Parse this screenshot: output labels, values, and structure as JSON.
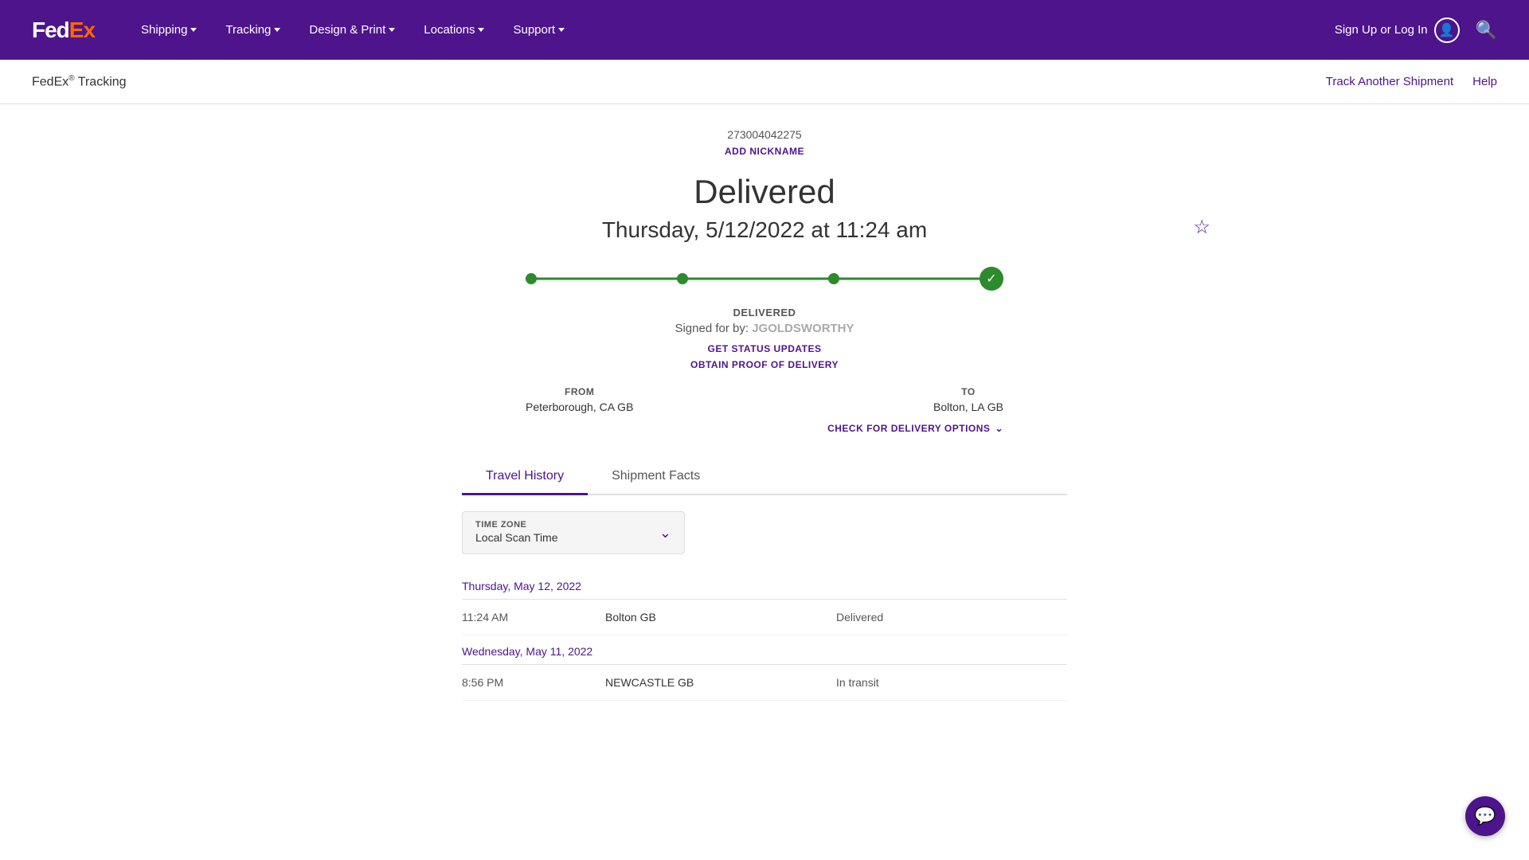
{
  "nav": {
    "logo_fed": "Fed",
    "logo_ex": "Ex",
    "links": [
      {
        "label": "Shipping",
        "id": "shipping"
      },
      {
        "label": "Tracking",
        "id": "tracking"
      },
      {
        "label": "Design & Print",
        "id": "design-print"
      },
      {
        "label": "Locations",
        "id": "locations"
      },
      {
        "label": "Support",
        "id": "support"
      }
    ],
    "signin_label": "Sign Up or Log In"
  },
  "subheader": {
    "title": "FedEx",
    "sup": "®",
    "title_suffix": " Tracking",
    "track_another": "Track Another Shipment",
    "help": "Help"
  },
  "tracking": {
    "number": "273004042275",
    "add_nickname": "ADD NICKNAME"
  },
  "status": {
    "title": "Delivered",
    "date": "Thursday, 5/12/2022 at 11:24 am"
  },
  "delivered_info": {
    "label": "DELIVERED",
    "signed_for_prefix": "Signed for by: ",
    "signed_name": "JGOLDSWORTHY",
    "get_status_updates": "GET STATUS UPDATES",
    "obtain_proof": "OBTAIN PROOF OF DELIVERY"
  },
  "from_to": {
    "from_label": "FROM",
    "from_value": "Peterborough, CA GB",
    "to_label": "TO",
    "to_value": "Bolton, LA GB",
    "delivery_options": "CHECK FOR DELIVERY OPTIONS"
  },
  "tabs": {
    "travel_history": "Travel History",
    "shipment_facts": "Shipment Facts"
  },
  "timezone": {
    "label": "TIME ZONE",
    "value": "Local Scan Time"
  },
  "travel_history": {
    "groups": [
      {
        "date": "Thursday, May 12, 2022",
        "rows": [
          {
            "time": "11:24 AM",
            "location": "Bolton GB",
            "status": "Delivered"
          }
        ]
      },
      {
        "date": "Wednesday, May 11, 2022",
        "rows": [
          {
            "time": "8:56 PM",
            "location": "NEWCASTLE GB",
            "status": "In transit"
          }
        ]
      }
    ]
  },
  "colors": {
    "purple": "#4d148c",
    "orange": "#ff6600",
    "green": "#2d8a2d"
  }
}
